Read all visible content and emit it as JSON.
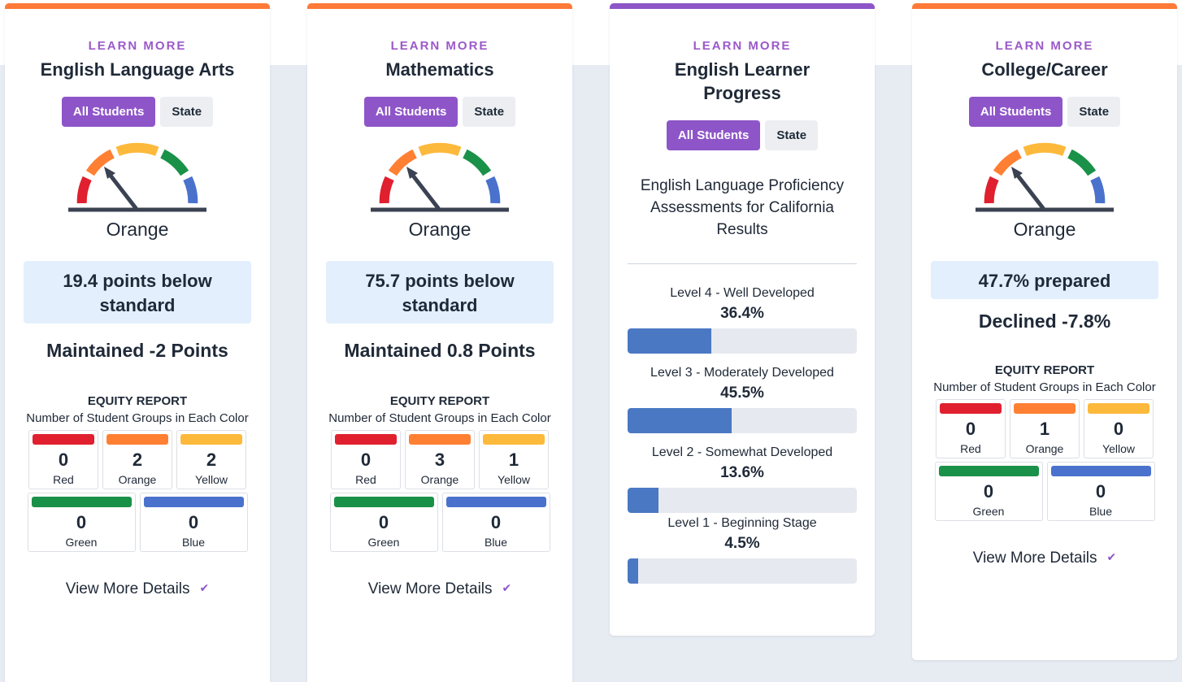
{
  "colors": {
    "orange_accent": "#ff7a38",
    "purple_accent": "#8e55c8",
    "red": "#e0202e",
    "orange": "#ff8033",
    "yellow": "#fdb93b",
    "green": "#1a9148",
    "blue": "#4a72cd"
  },
  "cards": [
    {
      "learn_more": "LEARN MORE",
      "title": "English Language Arts",
      "toggle_all": "All Students",
      "toggle_state": "State",
      "gauge_icon": "gauge-orange-icon",
      "gauge_label": "Orange",
      "status": "19.4 points below standard",
      "change": "Maintained -2 Points",
      "equity_heading": "EQUITY REPORT",
      "equity_sub": "Number of Student Groups in Each Color",
      "groups": {
        "red": {
          "count": "0",
          "label": "Red"
        },
        "orange": {
          "count": "2",
          "label": "Orange"
        },
        "yellow": {
          "count": "2",
          "label": "Yellow"
        },
        "green": {
          "count": "0",
          "label": "Green"
        },
        "blue": {
          "count": "0",
          "label": "Blue"
        }
      },
      "view_more": "View More Details"
    },
    {
      "learn_more": "LEARN MORE",
      "title": "Mathematics",
      "toggle_all": "All Students",
      "toggle_state": "State",
      "gauge_icon": "gauge-orange-icon",
      "gauge_label": "Orange",
      "status": "75.7 points below standard",
      "change": "Maintained 0.8 Points",
      "equity_heading": "EQUITY REPORT",
      "equity_sub": "Number of Student Groups in Each Color",
      "groups": {
        "red": {
          "count": "0",
          "label": "Red"
        },
        "orange": {
          "count": "3",
          "label": "Orange"
        },
        "yellow": {
          "count": "1",
          "label": "Yellow"
        },
        "green": {
          "count": "0",
          "label": "Green"
        },
        "blue": {
          "count": "0",
          "label": "Blue"
        }
      },
      "view_more": "View More Details"
    },
    {
      "learn_more": "LEARN MORE",
      "title": "English Learner Progress",
      "toggle_all": "All Students",
      "toggle_state": "State",
      "assessment": "English Language Proficiency Assessments for California Results",
      "levels": [
        {
          "label": "Level 4 - Well Developed",
          "pct": "36.4%",
          "value": 36.4
        },
        {
          "label": "Level 3 - Moderately Developed",
          "pct": "45.5%",
          "value": 45.5
        },
        {
          "label": "Level 2 - Somewhat Developed",
          "pct": "13.6%",
          "value": 13.6
        },
        {
          "label": "Level 1 - Beginning Stage",
          "pct": "4.5%",
          "value": 4.5
        }
      ]
    },
    {
      "learn_more": "LEARN MORE",
      "title": "College/Career",
      "toggle_all": "All Students",
      "toggle_state": "State",
      "gauge_icon": "gauge-orange-icon",
      "gauge_label": "Orange",
      "status": "47.7% prepared",
      "change": "Declined -7.8%",
      "equity_heading": "EQUITY REPORT",
      "equity_sub": "Number of Student Groups in Each Color",
      "groups": {
        "red": {
          "count": "0",
          "label": "Red"
        },
        "orange": {
          "count": "1",
          "label": "Orange"
        },
        "yellow": {
          "count": "0",
          "label": "Yellow"
        },
        "green": {
          "count": "0",
          "label": "Green"
        },
        "blue": {
          "count": "0",
          "label": "Blue"
        }
      },
      "view_more": "View More Details"
    }
  ]
}
